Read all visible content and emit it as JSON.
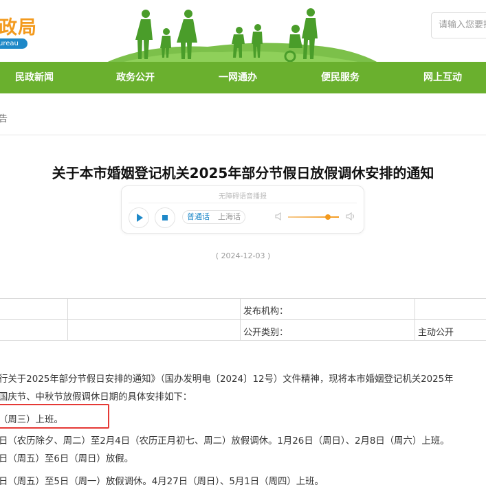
{
  "header": {
    "logo_text": "政局",
    "logo_sub": "ureau",
    "search_placeholder": "请输入您要搜"
  },
  "nav": {
    "items": [
      "民政新闻",
      "政务公开",
      "一网通办",
      "便民服务",
      "网上互动"
    ]
  },
  "breadcrumb": {
    "text": "告"
  },
  "article": {
    "title": "关于本市婚姻登记机关2025年部分节假日放假调休安排的通知",
    "date": "( 2024-12-03 )"
  },
  "player": {
    "label": "无障碍语音播报",
    "languages": [
      "普通话",
      "上海话"
    ],
    "volume": 0.8
  },
  "info_table": {
    "publisher_label": "发布机构：",
    "publisher_value": "",
    "category_label": "公开类别：",
    "category_value": "主动公开"
  },
  "body": {
    "paragraphs": [
      "行关于2025年部分节假日安排的通知》（国办发明电〔2024〕12号）文件精神，现将本市婚姻登记机关2025年",
      "国庆节、中秋节放假调休日期的具体安排如下：",
      "（周三）上班。",
      "日（农历除夕、周二）至2月4日（农历正月初七、周二）放假调休。1月26日（周日）、2月8日（周六）上班。",
      "日（周五）至6日（周日）放假。",
      "日（周五）至5日（周一）放假调休。4月27日（周日）、5月1日（周四）上班。"
    ]
  },
  "colors": {
    "nav_green": "#6ab02e",
    "logo_orange": "#f39a1e",
    "highlight_red": "#e53935",
    "link_blue": "#1e88c8"
  }
}
